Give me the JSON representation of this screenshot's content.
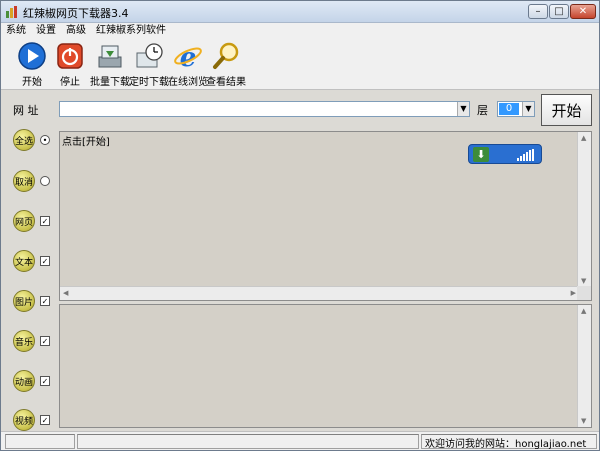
{
  "window": {
    "title": "红辣椒网页下载器3.4"
  },
  "menu": {
    "items": [
      "系统",
      "设置",
      "高级",
      "红辣椒系列软件"
    ]
  },
  "toolbar": {
    "buttons": [
      {
        "label": "开始",
        "icon": "play-icon"
      },
      {
        "label": "停止",
        "icon": "stop-icon"
      },
      {
        "label": "批量下载",
        "icon": "batch-download-icon"
      },
      {
        "label": "定时下载",
        "icon": "clock-icon"
      },
      {
        "label": "在线浏览",
        "icon": "ie-browser-icon"
      },
      {
        "label": "查看结果",
        "icon": "magnifier-icon"
      }
    ]
  },
  "address": {
    "label": "网 址",
    "value": ""
  },
  "layer": {
    "label": "层",
    "value": "0"
  },
  "start_button": {
    "label": "开始"
  },
  "sidebar": {
    "items": [
      {
        "label": "全选",
        "control": "radio",
        "checked": true
      },
      {
        "label": "取消",
        "control": "radio",
        "checked": false
      },
      {
        "label": "网页",
        "control": "checkbox",
        "checked": true
      },
      {
        "label": "文本",
        "control": "checkbox",
        "checked": true
      },
      {
        "label": "图片",
        "control": "checkbox",
        "checked": true
      },
      {
        "label": "音乐",
        "control": "checkbox",
        "checked": true
      },
      {
        "label": "动画",
        "control": "checkbox",
        "checked": true
      },
      {
        "label": "视频",
        "control": "checkbox",
        "checked": true
      }
    ]
  },
  "top_pane": {
    "hint": "点击[开始]"
  },
  "status": {
    "text": "欢迎访问我的网站：honglajiao.net"
  },
  "colors": {
    "accent": "#2a6fd1",
    "side_circle": "#d8d060",
    "title_gradient": "#c4d4e8"
  }
}
